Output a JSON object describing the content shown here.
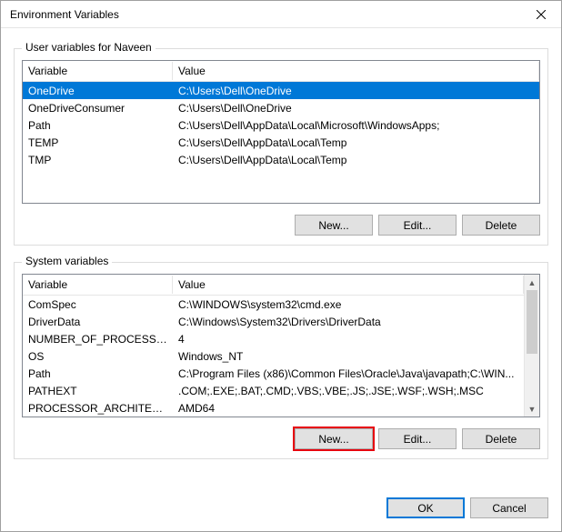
{
  "window": {
    "title": "Environment Variables"
  },
  "user_section": {
    "title": "User variables for Naveen",
    "headers": {
      "variable": "Variable",
      "value": "Value"
    },
    "rows": [
      {
        "variable": "OneDrive",
        "value": "C:\\Users\\Dell\\OneDrive",
        "selected": true
      },
      {
        "variable": "OneDriveConsumer",
        "value": "C:\\Users\\Dell\\OneDrive"
      },
      {
        "variable": "Path",
        "value": "C:\\Users\\Dell\\AppData\\Local\\Microsoft\\WindowsApps;"
      },
      {
        "variable": "TEMP",
        "value": "C:\\Users\\Dell\\AppData\\Local\\Temp"
      },
      {
        "variable": "TMP",
        "value": "C:\\Users\\Dell\\AppData\\Local\\Temp"
      }
    ],
    "buttons": {
      "new": "New...",
      "edit": "Edit...",
      "delete": "Delete"
    }
  },
  "system_section": {
    "title": "System variables",
    "headers": {
      "variable": "Variable",
      "value": "Value"
    },
    "rows": [
      {
        "variable": "ComSpec",
        "value": "C:\\WINDOWS\\system32\\cmd.exe"
      },
      {
        "variable": "DriverData",
        "value": "C:\\Windows\\System32\\Drivers\\DriverData"
      },
      {
        "variable": "NUMBER_OF_PROCESSORS",
        "value": "4"
      },
      {
        "variable": "OS",
        "value": "Windows_NT"
      },
      {
        "variable": "Path",
        "value": "C:\\Program Files (x86)\\Common Files\\Oracle\\Java\\javapath;C:\\WIN..."
      },
      {
        "variable": "PATHEXT",
        "value": ".COM;.EXE;.BAT;.CMD;.VBS;.VBE;.JS;.JSE;.WSF;.WSH;.MSC"
      },
      {
        "variable": "PROCESSOR_ARCHITECTURE",
        "value": "AMD64"
      }
    ],
    "buttons": {
      "new": "New...",
      "edit": "Edit...",
      "delete": "Delete"
    }
  },
  "dialog_buttons": {
    "ok": "OK",
    "cancel": "Cancel"
  }
}
